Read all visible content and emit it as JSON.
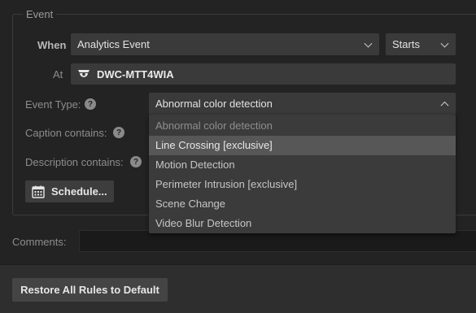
{
  "event": {
    "legend": "Event",
    "when_label": "When",
    "when_value": "Analytics Event",
    "starts_value": "Starts",
    "at_label": "At",
    "at_value": "DWC-MTT4WIA",
    "event_type_label": "Event Type:",
    "event_type_value": "Abnormal color detection",
    "caption_label": "Caption contains:",
    "description_label": "Description contains:",
    "help_glyph": "?",
    "schedule_label": "Schedule..."
  },
  "dropdown": {
    "options": [
      "Abnormal color detection",
      "Line Crossing [exclusive]",
      "Motion Detection",
      "Perimeter Intrusion [exclusive]",
      "Scene Change",
      "Video Blur Detection"
    ],
    "selected_index": 0,
    "hover_index": 1
  },
  "comments": {
    "label": "Comments:",
    "value": ""
  },
  "footer": {
    "restore_label": "Restore All Rules to Default"
  },
  "icons": {
    "camera": "camera-icon",
    "calendar": "calendar-icon",
    "help": "help-icon"
  }
}
